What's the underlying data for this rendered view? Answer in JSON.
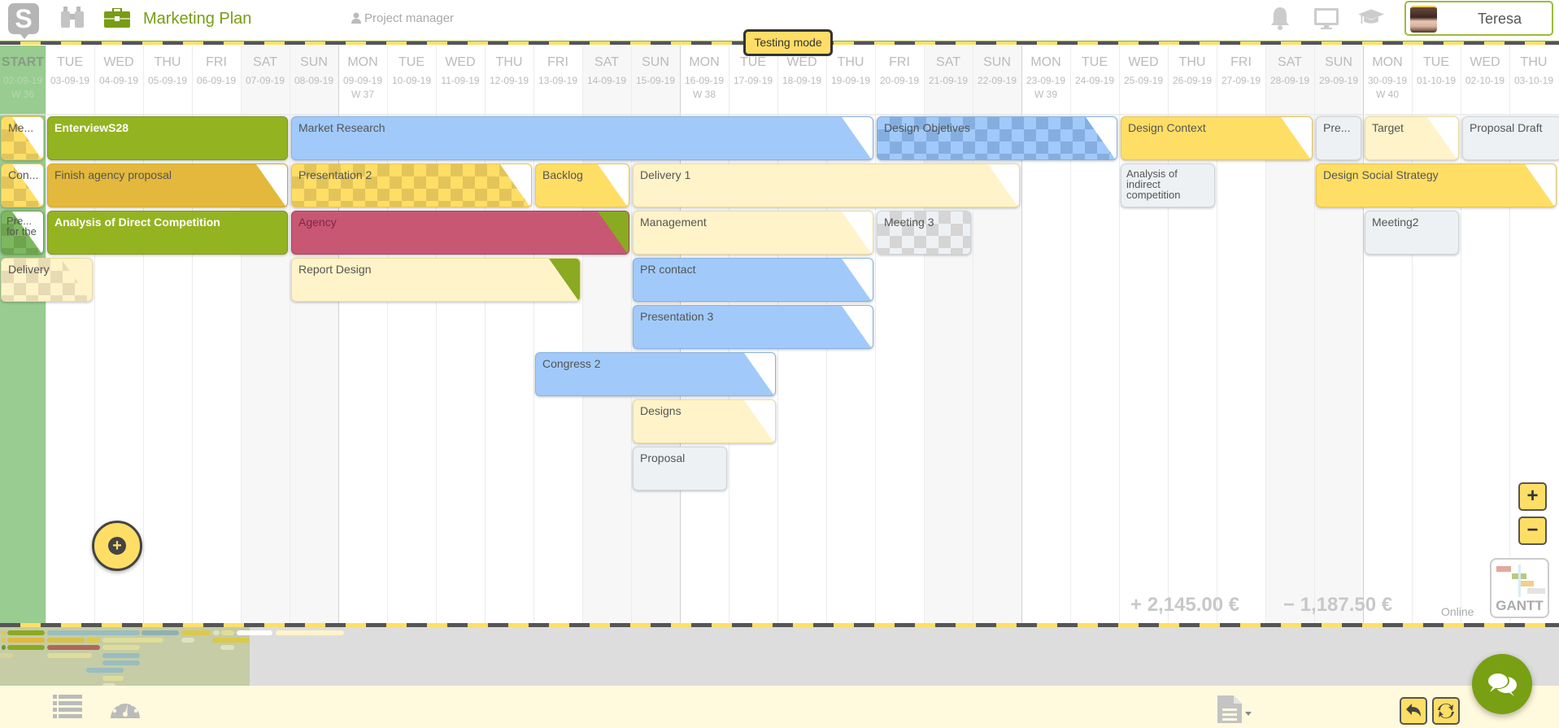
{
  "header": {
    "logo_letter": "S",
    "project_title": "Marketing Plan",
    "role": "Project manager",
    "user_name": "Teresa",
    "testing_badge": "Testing mode",
    "icons": [
      "logo-icon",
      "binoculars-icon",
      "briefcase-icon",
      "user-icon",
      "bell-icon",
      "monitor-icon",
      "graduation-cap-icon"
    ]
  },
  "timeline": {
    "start_column": {
      "label": "START",
      "date": "02-09-19",
      "week": "W 36"
    },
    "days": [
      {
        "name": "TUE",
        "date": "03-09-19",
        "week": ""
      },
      {
        "name": "WED",
        "date": "04-09-19",
        "week": ""
      },
      {
        "name": "THU",
        "date": "05-09-19",
        "week": ""
      },
      {
        "name": "FRI",
        "date": "06-09-19",
        "week": ""
      },
      {
        "name": "SAT",
        "date": "07-09-19",
        "week": ""
      },
      {
        "name": "SUN",
        "date": "08-09-19",
        "week": ""
      },
      {
        "name": "MON",
        "date": "09-09-19",
        "week": "W 37"
      },
      {
        "name": "TUE",
        "date": "10-09-19",
        "week": ""
      },
      {
        "name": "WED",
        "date": "11-09-19",
        "week": ""
      },
      {
        "name": "THU",
        "date": "12-09-19",
        "week": ""
      },
      {
        "name": "FRI",
        "date": "13-09-19",
        "week": ""
      },
      {
        "name": "SAT",
        "date": "14-09-19",
        "week": ""
      },
      {
        "name": "SUN",
        "date": "15-09-19",
        "week": ""
      },
      {
        "name": "MON",
        "date": "16-09-19",
        "week": "W 38"
      },
      {
        "name": "TUE",
        "date": "17-09-19",
        "week": ""
      },
      {
        "name": "WED",
        "date": "18-09-19",
        "week": ""
      },
      {
        "name": "THU",
        "date": "19-09-19",
        "week": ""
      },
      {
        "name": "FRI",
        "date": "20-09-19",
        "week": ""
      },
      {
        "name": "SAT",
        "date": "21-09-19",
        "week": ""
      },
      {
        "name": "SUN",
        "date": "22-09-19",
        "week": ""
      },
      {
        "name": "MON",
        "date": "23-09-19",
        "week": "W 39"
      },
      {
        "name": "TUE",
        "date": "24-09-19",
        "week": ""
      },
      {
        "name": "WED",
        "date": "25-09-19",
        "week": ""
      },
      {
        "name": "THU",
        "date": "26-09-19",
        "week": ""
      },
      {
        "name": "FRI",
        "date": "27-09-19",
        "week": ""
      },
      {
        "name": "SAT",
        "date": "28-09-19",
        "week": ""
      },
      {
        "name": "SUN",
        "date": "29-09-19",
        "week": ""
      },
      {
        "name": "MON",
        "date": "30-09-19",
        "week": "W 40"
      },
      {
        "name": "TUE",
        "date": "01-10-19",
        "week": ""
      },
      {
        "name": "WED",
        "date": "02-10-19",
        "week": ""
      },
      {
        "name": "THU",
        "date": "03-10-19",
        "week": ""
      }
    ]
  },
  "tasks": [
    {
      "label": "Me...",
      "row": 0,
      "start": -1,
      "end": -1,
      "color": "yellow",
      "pattern": "checker",
      "corner": "white"
    },
    {
      "label": "EnterviewS28",
      "row": 0,
      "start": 0,
      "end": 4,
      "color": "green",
      "pattern": "",
      "corner": ""
    },
    {
      "label": "Market Research",
      "row": 0,
      "start": 5,
      "end": 16,
      "color": "blue",
      "pattern": "",
      "corner": "white"
    },
    {
      "label": "Design Objetives",
      "row": 0,
      "start": 17,
      "end": 21,
      "color": "blue",
      "pattern": "checker",
      "corner": "white"
    },
    {
      "label": "Design Context",
      "row": 0,
      "start": 22,
      "end": 25,
      "color": "yellow",
      "pattern": "",
      "corner": "white"
    },
    {
      "label": "Pre...",
      "row": 0,
      "start": 26,
      "end": 26,
      "color": "grey",
      "pattern": "",
      "corner": ""
    },
    {
      "label": "Target",
      "row": 0,
      "start": 27,
      "end": 28,
      "color": "cream",
      "pattern": "",
      "corner": "white"
    },
    {
      "label": "Proposal Draft",
      "row": 0,
      "start": 29,
      "end": 31,
      "color": "grey",
      "pattern": "",
      "corner": ""
    },
    {
      "label": "Con...",
      "row": 1,
      "start": -1,
      "end": -1,
      "color": "yellow",
      "pattern": "checker",
      "corner": "white"
    },
    {
      "label": "Finish agency proposal",
      "row": 1,
      "start": 0,
      "end": 4,
      "color": "orange",
      "pattern": "",
      "corner": "white"
    },
    {
      "label": "Presentation 2",
      "row": 1,
      "start": 5,
      "end": 9,
      "color": "yellow",
      "pattern": "checker",
      "corner": "white"
    },
    {
      "label": "Backlog",
      "row": 1,
      "start": 10,
      "end": 11,
      "color": "yellow",
      "pattern": "",
      "corner": "white"
    },
    {
      "label": "Delivery 1",
      "row": 1,
      "start": 12,
      "end": 19,
      "color": "cream",
      "pattern": "",
      "corner": "white"
    },
    {
      "label": "Analysis of indirect competition",
      "row": 1,
      "start": 22,
      "end": 23,
      "color": "grey",
      "pattern": "",
      "corner": "",
      "wrap": true
    },
    {
      "label": "Design Social Strategy",
      "row": 1,
      "start": 26,
      "end": 30,
      "color": "yellow",
      "pattern": "",
      "corner": "white"
    },
    {
      "label": "Pre... for the",
      "row": 2,
      "start": -1,
      "end": -1,
      "color": "darkgreen",
      "pattern": "checker",
      "corner": "white",
      "wrap": true
    },
    {
      "label": "Analysis of Direct Competition",
      "row": 2,
      "start": 0,
      "end": 4,
      "color": "green",
      "pattern": "",
      "corner": ""
    },
    {
      "label": "Agency",
      "row": 2,
      "start": 5,
      "end": 11,
      "color": "red",
      "pattern": "",
      "corner": "green"
    },
    {
      "label": "Management",
      "row": 2,
      "start": 12,
      "end": 16,
      "color": "cream",
      "pattern": "",
      "corner": "white"
    },
    {
      "label": "Meeting 3",
      "row": 2,
      "start": 17,
      "end": 18,
      "color": "grey",
      "pattern": "checker",
      "corner": ""
    },
    {
      "label": "Meeting2",
      "row": 2,
      "start": 27,
      "end": 28,
      "color": "grey",
      "pattern": "",
      "corner": ""
    },
    {
      "label": "Delivery",
      "row": 3,
      "start": -1,
      "end": 0,
      "color": "cream",
      "pattern": "checker",
      "corner": "cream"
    },
    {
      "label": "Report Design",
      "row": 3,
      "start": 5,
      "end": 10,
      "color": "cream",
      "pattern": "",
      "corner": "green"
    },
    {
      "label": "PR contact",
      "row": 3,
      "start": 12,
      "end": 16,
      "color": "blue",
      "pattern": "",
      "corner": "white"
    },
    {
      "label": "Presentation 3",
      "row": 4,
      "start": 12,
      "end": 16,
      "color": "blue",
      "pattern": "",
      "corner": "white"
    },
    {
      "label": "Congress 2",
      "row": 5,
      "start": 10,
      "end": 14,
      "color": "blue",
      "pattern": "",
      "corner": "white"
    },
    {
      "label": "Designs",
      "row": 6,
      "start": 12,
      "end": 14,
      "color": "cream",
      "pattern": "",
      "corner": "white"
    },
    {
      "label": "Proposal",
      "row": 7,
      "start": 12,
      "end": 13,
      "color": "grey",
      "pattern": "",
      "corner": ""
    }
  ],
  "summary": {
    "income": "2,145.00 €",
    "expense": "1,187.50 €",
    "status": "Online",
    "view_label": "GANTT"
  },
  "controls": {
    "zoom_in": "+",
    "zoom_out": "−",
    "add": "+"
  },
  "footer": {
    "icons": [
      "list-icon",
      "dashboard-icon",
      "document-icon",
      "undo-icon",
      "refresh-icon",
      "chat-icon"
    ]
  }
}
